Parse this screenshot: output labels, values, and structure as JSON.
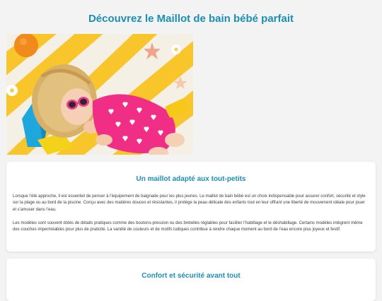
{
  "page": {
    "title": "Découvrez le Maillot de bain bébé parfait"
  },
  "hero": {
    "image_name": "baby-in-pink-swimsuit-photo"
  },
  "sections": [
    {
      "heading": "Un maillot adapté aux tout-petits",
      "paragraphs": [
        "Lorsque l’été approche, il est essentiel de penser à l’équipement de baignade pour les plus jeunes. Le maillot de bain bébé est un choix indispensable pour assurer confort, sécurité et style sur la plage ou au bord de la piscine. Conçu avec des matières douces et résistantes, il protège la peau délicate des enfants tout en leur offrant une liberté de mouvement idéale pour jouer et s’amuser dans l’eau.",
        "Les modèles sont souvent dotés de détails pratiques comme des boutons-pression ou des bretelles réglables pour faciliter l’habillage et le déshabillage. Certains modèles intègrent même des couches imperméables pour plus de praticité. La variété de couleurs et de motifs ludiques contribue à rendre chaque moment au bord de l’eau encore plus joyeux et festif."
      ]
    },
    {
      "heading": "Confort et sécurité avant tout"
    }
  ],
  "colors": {
    "accent": "#1b8fb3",
    "background": "#f3f3f3",
    "card": "#ffffff",
    "text": "#3a3a3a"
  }
}
